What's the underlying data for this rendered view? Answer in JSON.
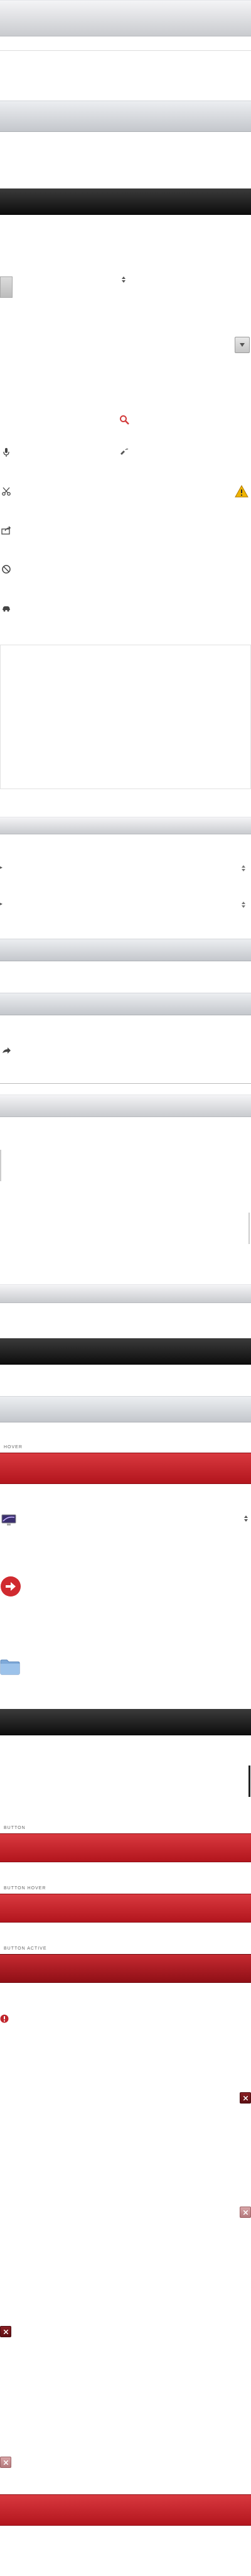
{
  "labels": {
    "hover": "hover",
    "button": "button",
    "button_hover": "button hover",
    "button_active": "button active"
  },
  "icons": [
    "sort-arrows-icon",
    "search-icon",
    "microphone-icon",
    "satellite-icon",
    "scissors-icon",
    "warning-icon",
    "share-icon",
    "no-entry-icon",
    "car-icon",
    "chevron-right-icon",
    "display-icon",
    "arrow-circle-icon",
    "folder-icon",
    "error-icon",
    "close-icon"
  ],
  "colors": {
    "red": "#c62a31",
    "dark": "#1a1a1a",
    "light": "#d8dadd",
    "accent_search": "#d23a3a",
    "warning": "#f0b400"
  }
}
